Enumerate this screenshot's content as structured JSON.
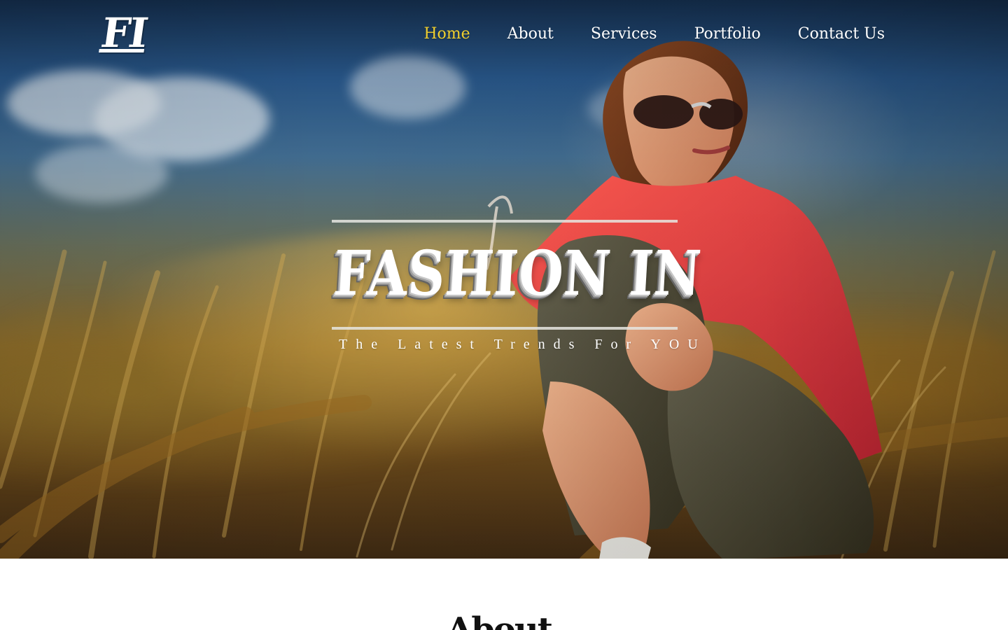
{
  "header": {
    "logo": "FI",
    "nav": {
      "home": "Home",
      "about": "About",
      "services": "Services",
      "portfolio": "Portfolio",
      "contact": "Contact Us"
    }
  },
  "hero": {
    "title": "FASHION IN",
    "subtitle": "The Latest Trends For YOU"
  },
  "below_hero": {
    "visible_heading_fragment": "About"
  },
  "colors": {
    "active_nav": "#f0cf2e",
    "text": "#ffffff",
    "rule": "#e6e6e2"
  }
}
